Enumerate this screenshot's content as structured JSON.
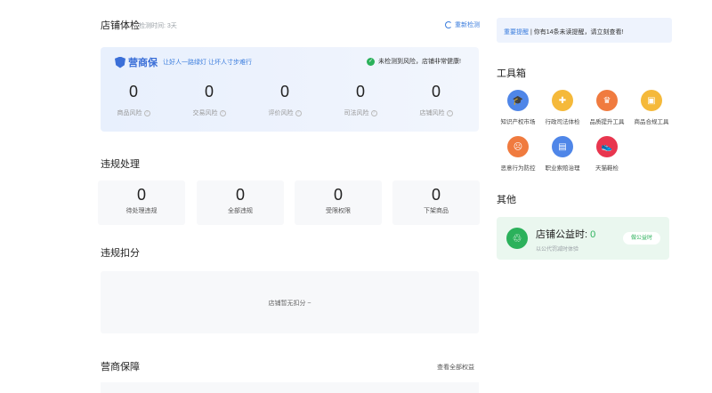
{
  "health": {
    "title": "店铺体检",
    "subtitle": "检测时间: 3天",
    "redetect": "重新检测",
    "brand": "营商保",
    "slogan": "让好人一路绿灯 让坏人寸步难行",
    "safe_text": "未检测到风险，店铺非常健康!",
    "risks": [
      {
        "value": "0",
        "label": "商品风险"
      },
      {
        "value": "0",
        "label": "交易风险"
      },
      {
        "value": "0",
        "label": "评价风险"
      },
      {
        "value": "0",
        "label": "司法风险"
      },
      {
        "value": "0",
        "label": "店铺风险"
      }
    ]
  },
  "violations": {
    "title": "违规处理",
    "items": [
      {
        "value": "0",
        "label": "待处理违规"
      },
      {
        "value": "0",
        "label": "全部违规"
      },
      {
        "value": "0",
        "label": "受限权限"
      },
      {
        "value": "0",
        "label": "下架商品"
      }
    ]
  },
  "deduction": {
    "title": "违规扣分",
    "empty": "店铺暂无扣分 ~"
  },
  "guarantee": {
    "title": "营商保障",
    "link": "查看全部权益"
  },
  "notice": {
    "link": "重要提醒",
    "text": " | 你有14条未读提醒，请立刻查看!"
  },
  "tools": {
    "title": "工具箱",
    "items": [
      {
        "label": "知识产权市场",
        "icon": "graduation-icon",
        "color": "#4f86e8",
        "glyph": "🎓"
      },
      {
        "label": "行政司法体检",
        "icon": "medkit-icon",
        "color": "#f5b93a",
        "glyph": "✚"
      },
      {
        "label": "品质提升工具",
        "icon": "crown-icon",
        "color": "#f07b3f",
        "glyph": "♛"
      },
      {
        "label": "商品合规工具",
        "icon": "briefcase-icon",
        "color": "#f5b93a",
        "glyph": "▣"
      },
      {
        "label": "恶意行为防控",
        "icon": "sad-face-icon",
        "color": "#f07b3f",
        "glyph": "☹"
      },
      {
        "label": "职业索赔治理",
        "icon": "clipboard-icon",
        "color": "#4f86e8",
        "glyph": "▤"
      },
      {
        "label": "天猫鞋检",
        "icon": "shoe-icon",
        "color": "#e8364f",
        "glyph": "👟"
      }
    ]
  },
  "other": {
    "title": "其他",
    "charity_title": "店铺公益时:",
    "charity_value": "0",
    "charity_sub": "以公代罚减时体验",
    "charity_button": "做公益时"
  }
}
